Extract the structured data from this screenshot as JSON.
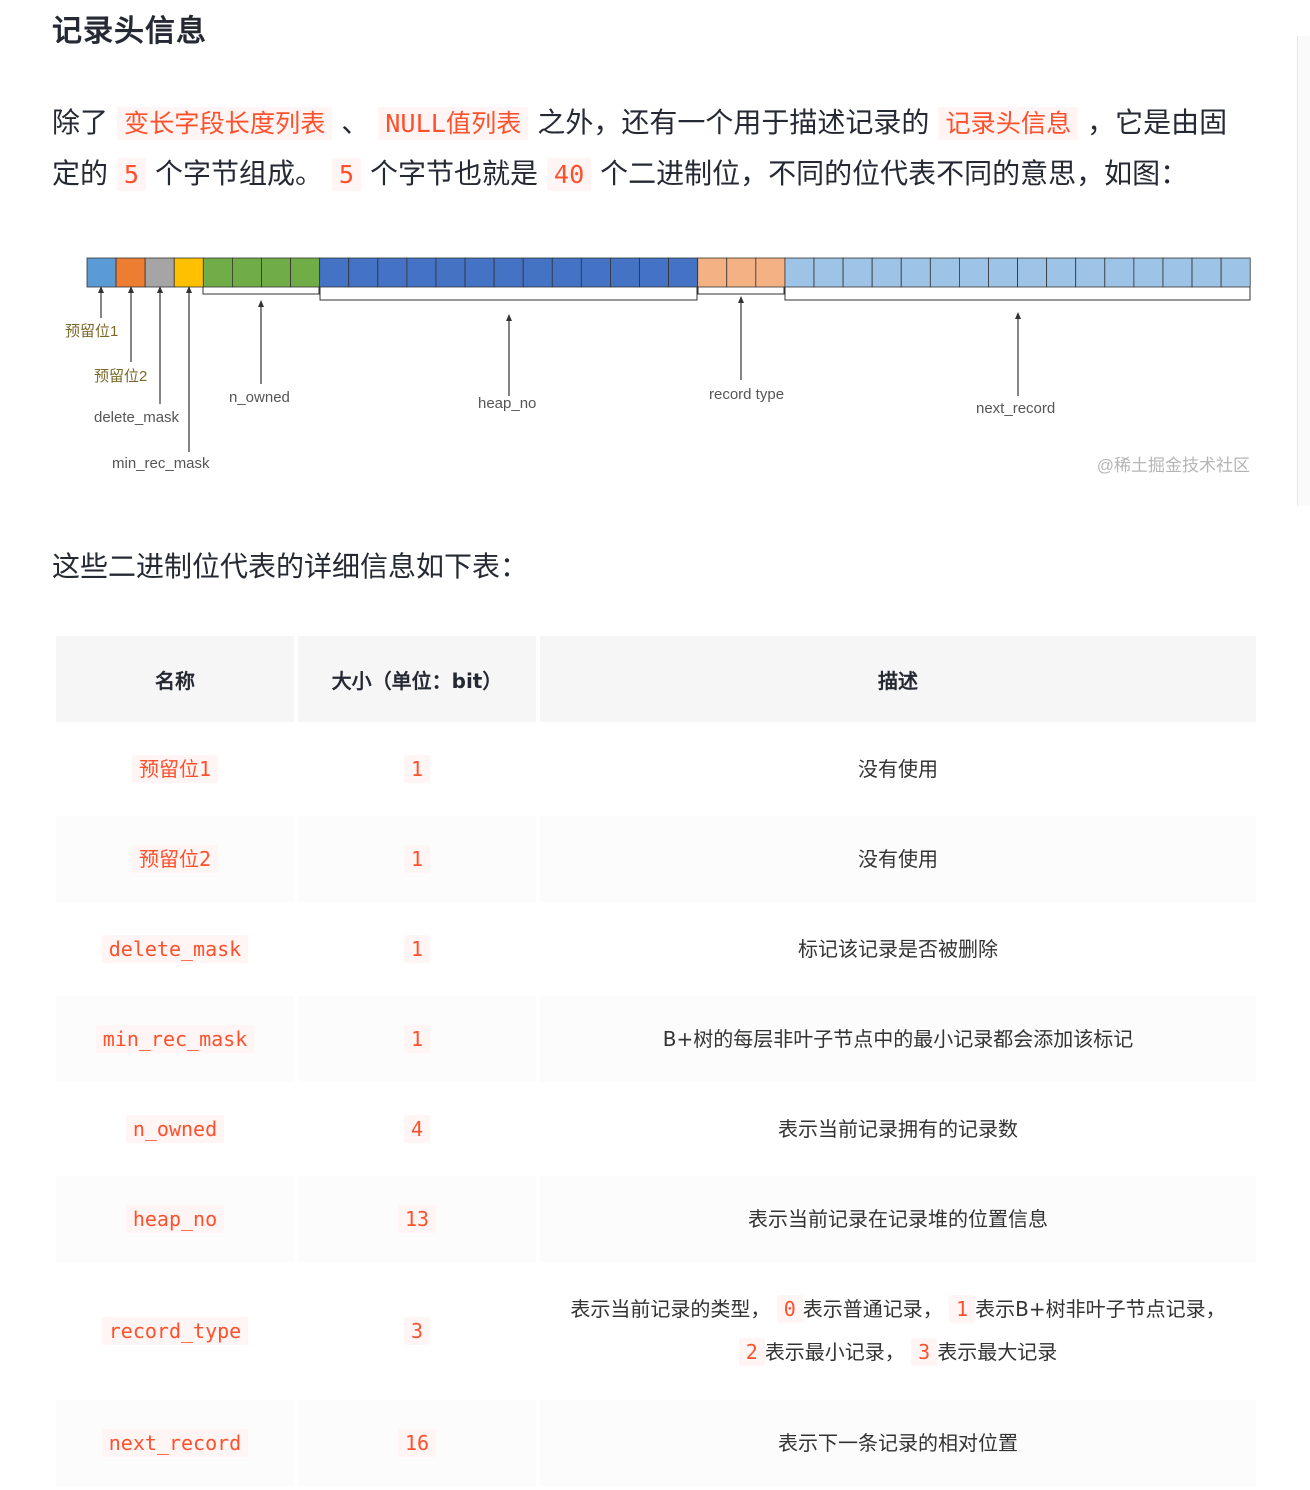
{
  "heading": "记录头信息",
  "paragraph1": {
    "t1": "除了",
    "c1": "变长字段长度列表",
    "t2": "、",
    "c2": "NULL值列表",
    "t3": "之外，还有一个用于描述记录的",
    "c3": "记录头信息",
    "t4": "，它是由固定的",
    "c4": "5",
    "t5": "个字节组成。",
    "c5": "5",
    "t6": "个字节也就是",
    "c6": "40",
    "t7": "个二进制位，不同的位代表不同的意思，如图："
  },
  "figure": {
    "labels": {
      "reserved1": "预留位1",
      "reserved2": "预留位2",
      "delete_mask": "delete_mask",
      "min_rec_mask": "min_rec_mask",
      "n_owned": "n_owned",
      "heap_no": "heap_no",
      "record_type": "record type",
      "next_record": "next_record"
    },
    "watermark": "@稀土掘金技术社区",
    "bit_groups": [
      {
        "bits": 1,
        "color": "#5b9bd5"
      },
      {
        "bits": 1,
        "color": "#ed7d31"
      },
      {
        "bits": 1,
        "color": "#a5a5a5"
      },
      {
        "bits": 1,
        "color": "#ffc000"
      },
      {
        "bits": 4,
        "color": "#70ad47"
      },
      {
        "bits": 13,
        "color": "#4472c4"
      },
      {
        "bits": 3,
        "color": "#f4b183"
      },
      {
        "bits": 16,
        "color": "#9dc3e6"
      }
    ]
  },
  "paragraph2": "这些二进制位代表的详细信息如下表：",
  "table": {
    "headers": [
      "名称",
      "大小（单位：bit）",
      "描述"
    ],
    "rows": [
      {
        "name": "预留位1",
        "size": "1",
        "desc": "没有使用"
      },
      {
        "name": "预留位2",
        "size": "1",
        "desc": "没有使用"
      },
      {
        "name": "delete_mask",
        "size": "1",
        "desc": "标记该记录是否被删除"
      },
      {
        "name": "min_rec_mask",
        "size": "1",
        "desc": "B+树的每层非叶子节点中的最小记录都会添加该标记"
      },
      {
        "name": "n_owned",
        "size": "4",
        "desc": "表示当前记录拥有的记录数"
      },
      {
        "name": "heap_no",
        "size": "13",
        "desc": "表示当前记录在记录堆的位置信息"
      },
      {
        "name": "record_type",
        "size": "3",
        "desc_parts": {
          "a": "表示当前记录的类型，",
          "c0": "0",
          "b": "表示普通记录，",
          "c1": "1",
          "c": "表示B+树非叶子节点记录，",
          "c2": "2",
          "d": "表示最小记录，",
          "c3": "3",
          "e": "表示最大记录"
        }
      },
      {
        "name": "next_record",
        "size": "16",
        "desc": "表示下一条记录的相对位置"
      }
    ]
  }
}
